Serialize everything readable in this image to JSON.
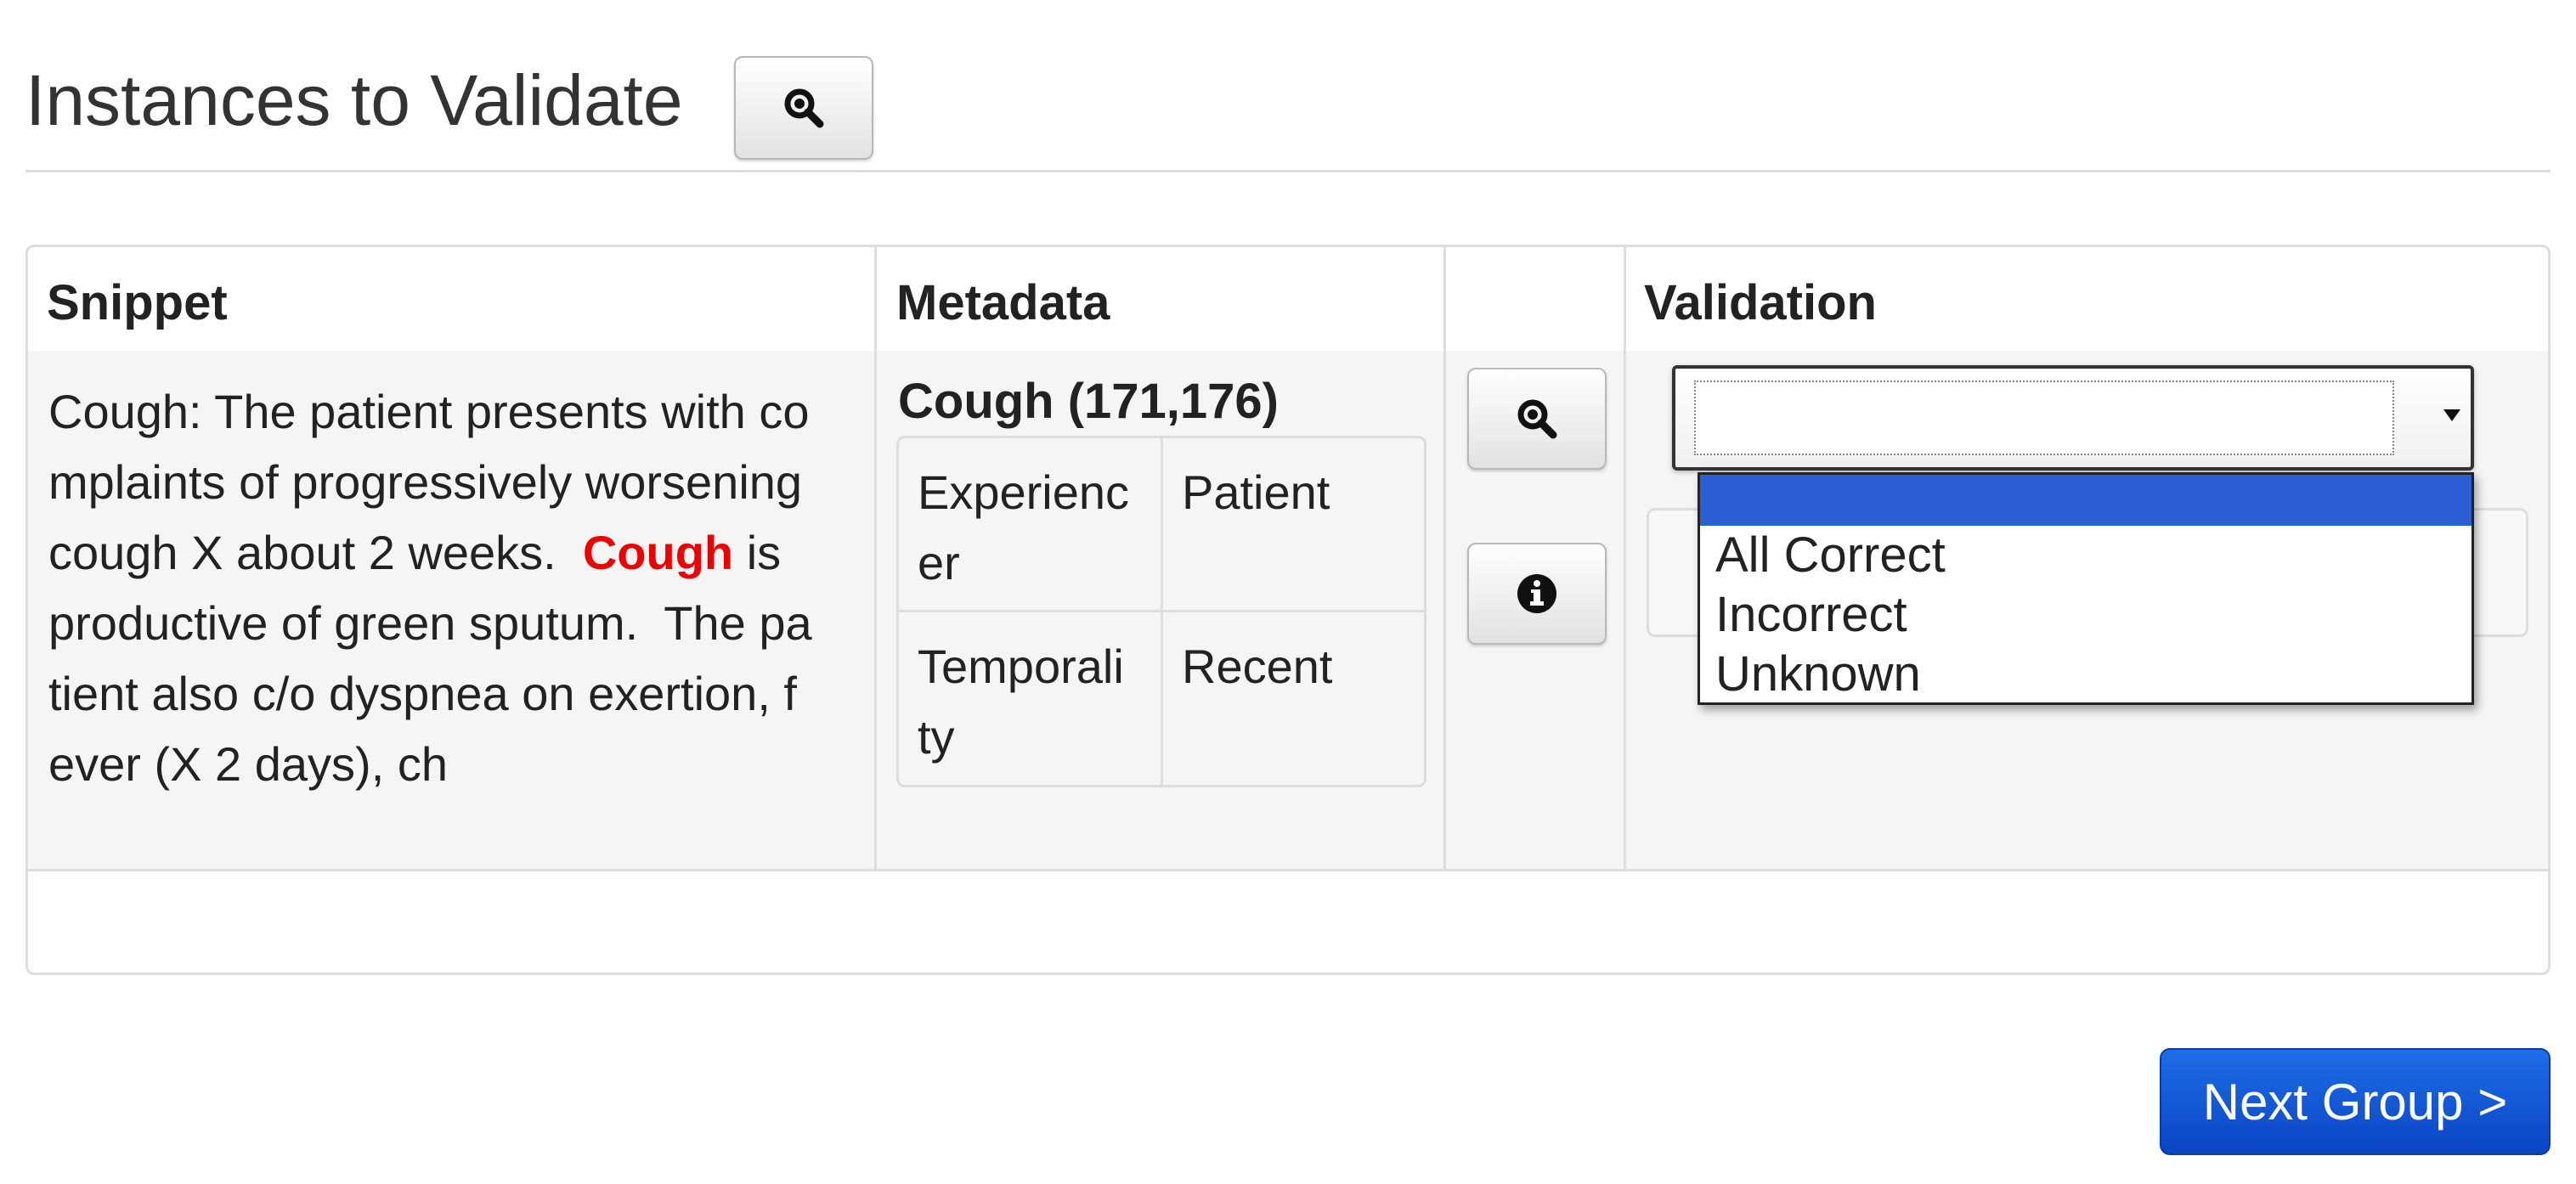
{
  "page": {
    "title": "Instances to Validate"
  },
  "table": {
    "headers": {
      "snippet": "Snippet",
      "metadata": "Metadata",
      "actions": "",
      "validation": "Validation"
    },
    "row": {
      "snippet_lines": [
        "Cough: The patient presents with co",
        "mplaints of progressively worsening",
        "cough X about 2 weeks.  ",
        "productive of green sputum.  The pa",
        "tient also c/o dyspnea on exertion, f",
        "ever (X 2 days), ch"
      ],
      "highlight_term": "Cough",
      "after_highlight": " is",
      "metadata": {
        "title": "Cough (171,176)",
        "attributes": [
          {
            "key": "Experiencer",
            "key_lines": [
              "Experienc",
              "er"
            ],
            "value": "Patient"
          },
          {
            "key": "Temporality",
            "key_lines": [
              "Temporali",
              "ty"
            ],
            "value": "Recent"
          }
        ]
      },
      "validation": {
        "selected": "",
        "options": [
          "",
          "All Correct",
          "Incorrect",
          "Unknown"
        ]
      }
    }
  },
  "footer": {
    "next_label": "Next Group >"
  },
  "colors": {
    "highlight": "#ee0000",
    "primary_button": "#0a45c4",
    "selected_option": "#2c5fd4"
  },
  "icons": {
    "title_button": "search-zoom-icon",
    "row_view": "search-zoom-icon",
    "row_info": "info-icon"
  }
}
